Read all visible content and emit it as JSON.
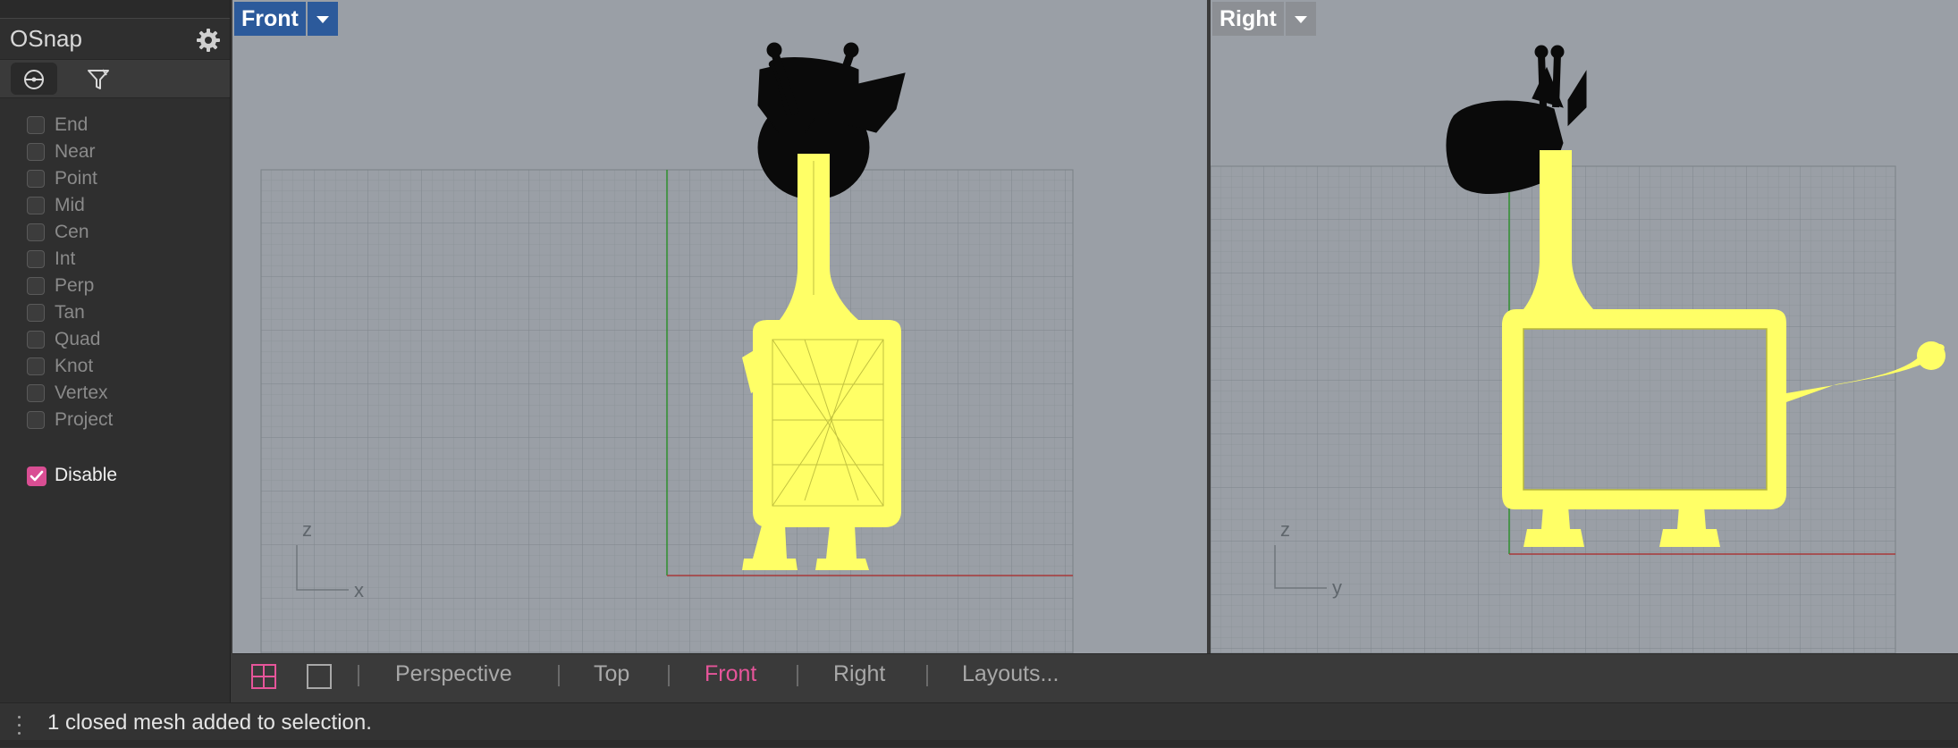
{
  "osnap": {
    "title": "OSnap",
    "settings_icon": "gear-icon",
    "tabs": [
      {
        "icon": "snap-target-icon",
        "active": true
      },
      {
        "icon": "filter-icon",
        "active": false
      }
    ],
    "items": [
      {
        "label": "End",
        "checked": false
      },
      {
        "label": "Near",
        "checked": false
      },
      {
        "label": "Point",
        "checked": false
      },
      {
        "label": "Mid",
        "checked": false
      },
      {
        "label": "Cen",
        "checked": false
      },
      {
        "label": "Int",
        "checked": false
      },
      {
        "label": "Perp",
        "checked": false
      },
      {
        "label": "Tan",
        "checked": false
      },
      {
        "label": "Quad",
        "checked": false
      },
      {
        "label": "Knot",
        "checked": false
      },
      {
        "label": "Vertex",
        "checked": false
      },
      {
        "label": "Project",
        "checked": false
      }
    ],
    "disable": {
      "label": "Disable",
      "checked": true
    }
  },
  "viewports": {
    "front": {
      "title": "Front",
      "axis_v": "z",
      "axis_h": "x",
      "active": true
    },
    "right": {
      "title": "Right",
      "axis_v": "z",
      "axis_h": "y",
      "active": false
    }
  },
  "viewport_tabs": {
    "items": [
      "Perspective",
      "Top",
      "Front",
      "Right",
      "Layouts..."
    ],
    "active": "Front"
  },
  "status": {
    "message": "1 closed mesh added to selection."
  },
  "colors": {
    "viewport_bg": "#9a9fa6",
    "grid_line": "#8a9197",
    "selection_yellow": "#ffff66",
    "active_accent": "#e6559a",
    "front_tab": "#2c5a9b",
    "x_axis": "#b03a3a",
    "z_axis": "#3a9a3a"
  }
}
